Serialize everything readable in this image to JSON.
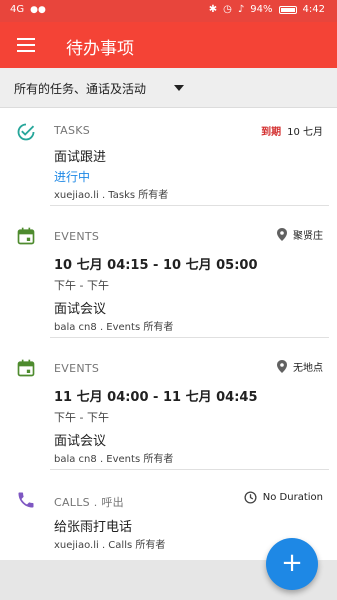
{
  "status_bar": {
    "network": "4G",
    "battery": "94%",
    "time": "4:42"
  },
  "app_bar": {
    "title": "待办事项",
    "menu_icon": "menu-icon"
  },
  "filter": {
    "selected": "所有的任务、通话及活动"
  },
  "items": [
    {
      "type_label": "TASKS",
      "icon": "task-check-icon",
      "due_label": "到期",
      "due_date": "10 七月",
      "title": "面试跟进",
      "status": "进行中",
      "owner": "xuejiao.li . Tasks 所有者"
    },
    {
      "type_label": "EVENTS",
      "icon": "calendar-icon",
      "location": "聚贤庄",
      "time_range": "10 七月 04:15 - 10 七月 05:00",
      "ampm": "下午 - 下午",
      "title": "面试会议",
      "owner": "bala cn8 . Events 所有者"
    },
    {
      "type_label": "EVENTS",
      "icon": "calendar-icon",
      "location": "无地点",
      "time_range": "11 七月 04:00 - 11 七月 04:45",
      "ampm": "下午 - 下午",
      "title": "面试会议",
      "owner": "bala cn8 . Events 所有者"
    },
    {
      "type_label": "CALLS . 呼出",
      "icon": "phone-icon",
      "duration": "No Duration",
      "title": "给张雨打电话",
      "owner": "xuejiao.li . Calls 所有者"
    }
  ],
  "fab": {
    "label": "+"
  },
  "colors": {
    "primary": "#f44336",
    "accent": "#1e88e5",
    "event_green": "#4e8b2e",
    "call_purple": "#7e57c2",
    "task_teal": "#26a69a",
    "due_red": "#d32f2f"
  }
}
